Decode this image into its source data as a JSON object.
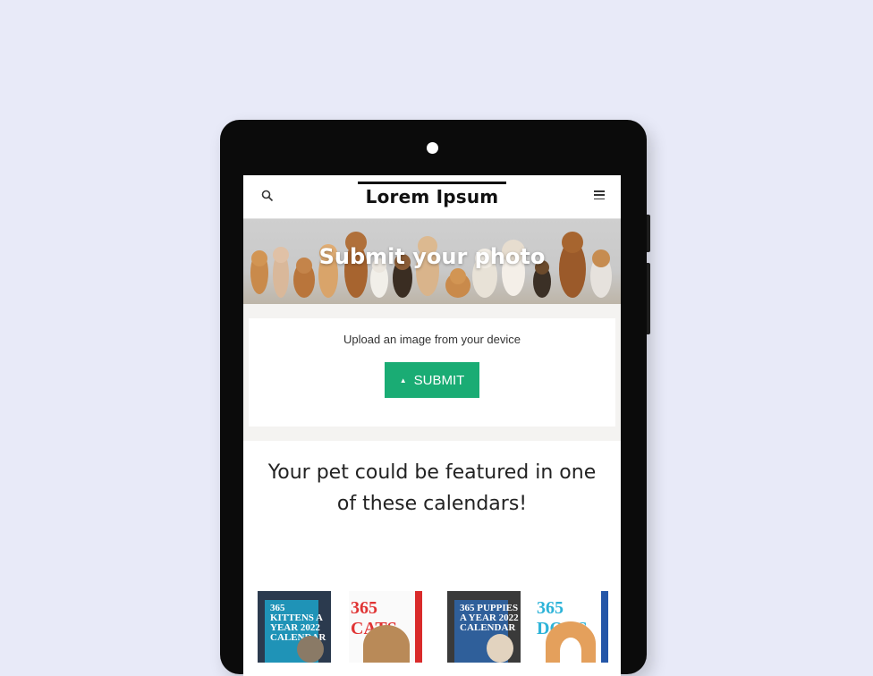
{
  "header": {
    "logo": "Lorem Ipsum",
    "search_icon": "search-icon",
    "menu_icon": "hamburger-menu-icon"
  },
  "hero": {
    "title": "Submit your photo"
  },
  "upload": {
    "prompt": "Upload an image from your device",
    "button_label": "SUBMIT",
    "button_icon": "up-arrow-icon",
    "button_color": "#1aac74"
  },
  "feature": {
    "line1": "Your pet could be featured in one",
    "line2": "of these calendars!"
  },
  "calendars": [
    {
      "title": "365 KITTENS A YEAR 2022 CALENDAR"
    },
    {
      "title": "365 CATS"
    },
    {
      "title": "365 PUPPIES A YEAR 2022 CALENDAR"
    },
    {
      "title": "365 DOGS"
    }
  ]
}
